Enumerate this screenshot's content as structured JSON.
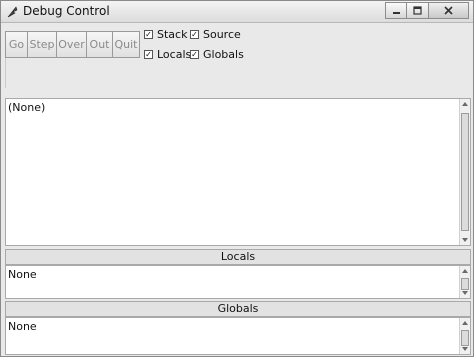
{
  "window": {
    "title": "Debug Control",
    "controls": {
      "minimize_icon": "minimize-icon",
      "maximize_icon": "maximize-icon",
      "close_icon": "close-icon"
    }
  },
  "toolbar": {
    "buttons": [
      {
        "label": "Go",
        "enabled": false
      },
      {
        "label": "Step",
        "enabled": false
      },
      {
        "label": "Over",
        "enabled": false
      },
      {
        "label": "Out",
        "enabled": false
      },
      {
        "label": "Quit",
        "enabled": false
      }
    ],
    "checkboxes": [
      {
        "label": "Stack",
        "checked": true
      },
      {
        "label": "Source",
        "checked": true
      },
      {
        "label": "Locals",
        "checked": true
      },
      {
        "label": "Globals",
        "checked": true
      }
    ],
    "check_mark": "✓"
  },
  "stack_pane": {
    "text": "(None)"
  },
  "locals": {
    "header": "Locals",
    "text": "None"
  },
  "globals": {
    "header": "Globals",
    "text": "None"
  }
}
